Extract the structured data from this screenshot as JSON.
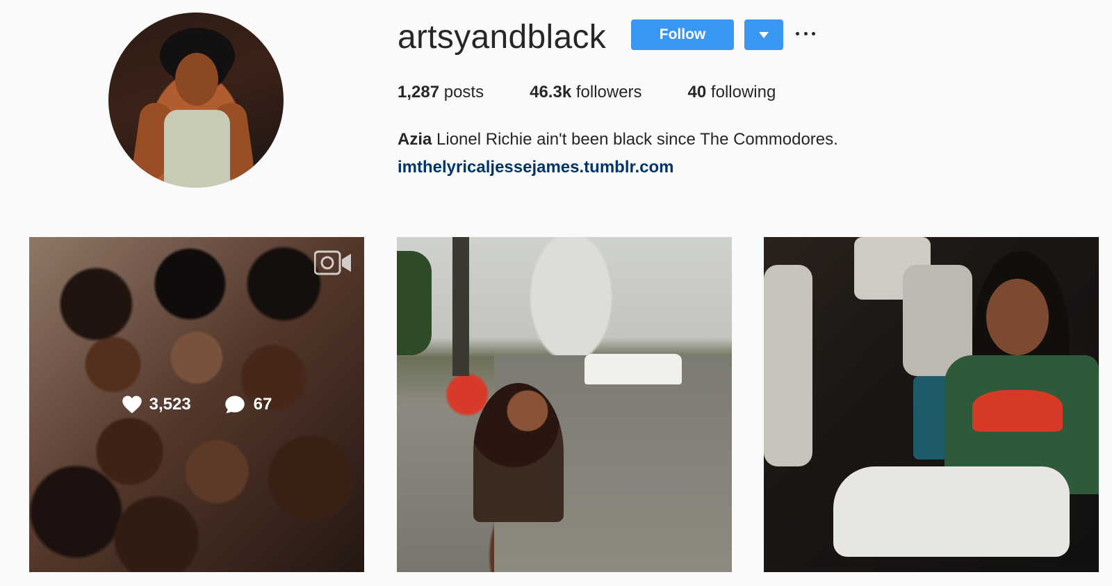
{
  "profile": {
    "username": "artsyandblack",
    "follow_label": "Follow",
    "stats": {
      "posts_count": "1,287",
      "posts_label": "posts",
      "followers_count": "46.3k",
      "followers_label": "followers",
      "following_count": "40",
      "following_label": "following"
    },
    "bio": {
      "name": "Azia",
      "text": "Lionel Richie ain't been black since The Commodores."
    },
    "link": "imthelyricaljessejames.tumblr.com"
  },
  "posts": [
    {
      "likes": "3,523",
      "comments": "67",
      "media": "video",
      "hovered": true
    },
    {
      "media": "image"
    },
    {
      "media": "image"
    }
  ],
  "colors": {
    "follow_button": "#3897f0",
    "link": "#003569",
    "background": "#fafafa"
  },
  "icons": [
    "dropdown-arrow-icon",
    "more-options-icon",
    "heart-icon",
    "comment-icon",
    "video-icon"
  ]
}
